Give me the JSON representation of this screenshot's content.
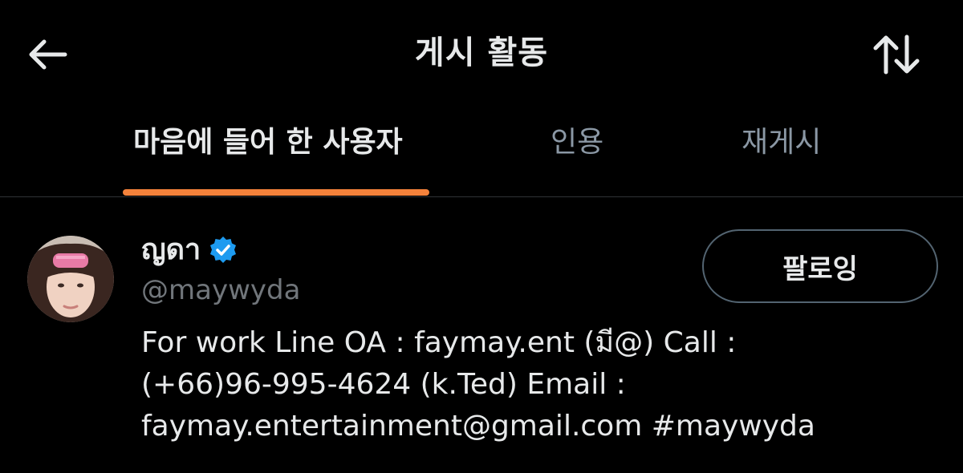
{
  "header": {
    "title": "게시 활동",
    "back_icon": "arrow-left-icon",
    "sort_icon": "sort-arrows-icon"
  },
  "tabs": [
    {
      "label": "마음에 들어 한 사용자",
      "active": true
    },
    {
      "label": "인용",
      "active": false
    },
    {
      "label": "재게시",
      "active": false
    }
  ],
  "colors": {
    "accent": "#f4823b",
    "verified": "#1d9bf0",
    "background": "#000000",
    "text_primary": "#e7e9ea",
    "text_secondary": "#71767b"
  },
  "user": {
    "name": "ญดา",
    "verified": true,
    "handle": "@maywyda",
    "follow_label": "팔로잉",
    "bio": "For work Line OA : faymay.ent (มี@) Call :\n(+66)96-995-4624 (k.Ted) Email :\nfaymay.entertainment@gmail.com #maywyda"
  }
}
